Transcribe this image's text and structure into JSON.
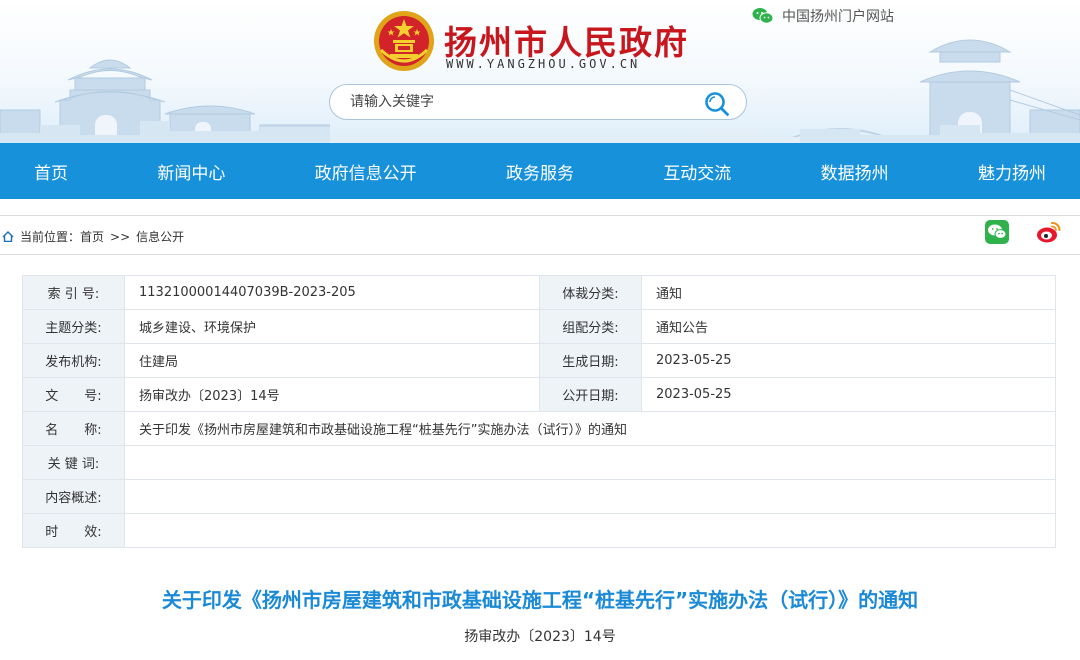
{
  "header": {
    "site_title": "扬州市人民政府",
    "site_domain": "WWW.YANGZHOU.GOV.CN",
    "portal_link": "中国扬州门户网站",
    "search_placeholder": "请输入关键字"
  },
  "nav": {
    "items": [
      "首页",
      "新闻中心",
      "政府信息公开",
      "政务服务",
      "互动交流",
      "数据扬州",
      "魅力扬州"
    ]
  },
  "breadcrumb": {
    "prefix": "当前位置：",
    "home": "首页",
    "separator": ">>",
    "current": "信息公开"
  },
  "meta": {
    "index_label": "索 引 号:",
    "index_value": "11321000014407039B-2023-205",
    "genre_label": "体裁分类:",
    "genre_value": "通知",
    "topic_label": "主题分类:",
    "topic_value": "城乡建设、环境保护",
    "category_label": "组配分类:",
    "category_value": "通知公告",
    "issuer_label": "发布机构:",
    "issuer_value": "住建局",
    "created_label": "生成日期:",
    "created_value": "2023-05-25",
    "docno_label": "文　　号:",
    "docno_value": "扬审改办〔2023〕14号",
    "published_label": "公开日期:",
    "published_value": "2023-05-25",
    "name_label": "名　　称:",
    "name_value": "关于印发《扬州市房屋建筑和市政基础设施工程“桩基先行”实施办法（试行）》的通知",
    "keywords_label": "关 键 词:",
    "keywords_value": "",
    "summary_label": "内容概述:",
    "summary_value": "",
    "validity_label": "时　　效:",
    "validity_value": ""
  },
  "document": {
    "title": "关于印发《扬州市房屋建筑和市政基础设施工程“桩基先行”实施办法（试行）》的通知",
    "number": "扬审改办〔2023〕14号"
  },
  "colors": {
    "nav_bg": "#1891db",
    "title_red": "#c8161d",
    "doc_title_blue": "#1b8ad6",
    "label_bg": "#eef3f8"
  },
  "icons": [
    "national-emblem-icon",
    "wechat-icon",
    "search-icon",
    "home-icon",
    "wechat-share-icon",
    "weibo-share-icon"
  ]
}
